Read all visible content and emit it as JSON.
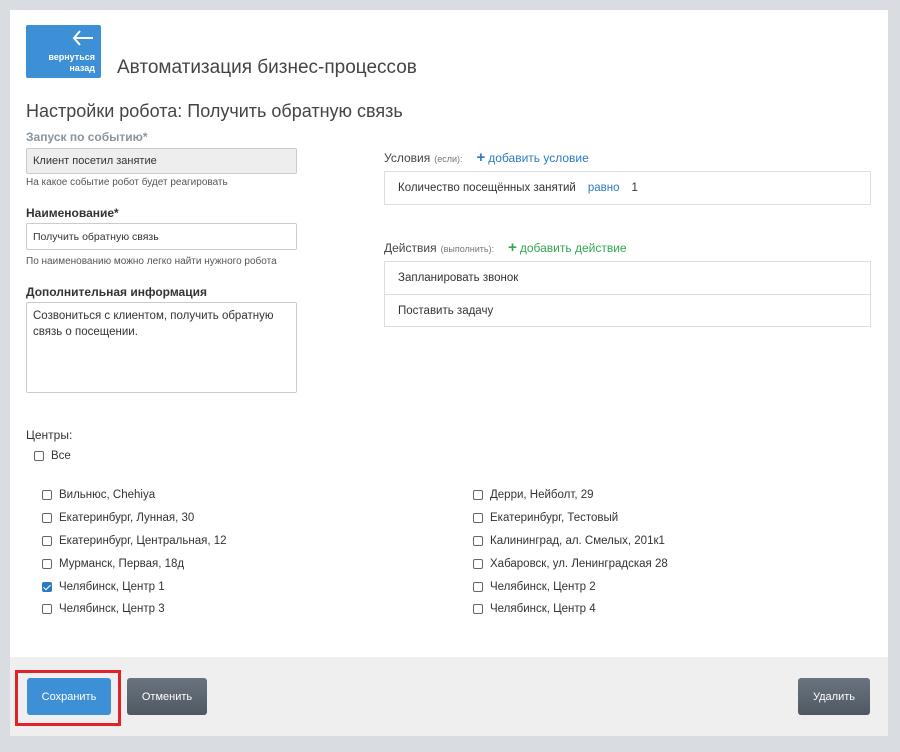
{
  "header": {
    "back_label_line1": "вернуться",
    "back_label_line2": "назад",
    "page_title": "Автоматизация бизнес-процессов",
    "section_title": "Настройки робота: Получить обратную связь"
  },
  "form": {
    "trigger_label": "Запуск по событию*",
    "trigger_value": "Клиент посетил занятие",
    "trigger_hint": "На какое событие робот будет реагировать",
    "name_label": "Наименование*",
    "name_value": "Получить обратную связь",
    "name_hint": "По наименованию можно легко найти нужного робота",
    "info_label": "Дополнительная информация",
    "info_value": "Созвониться с клиентом, получить обратную связь о посещении."
  },
  "conditions": {
    "title": "Условия",
    "subtitle": "(если):",
    "add_label": "добавить условие",
    "items": [
      {
        "field": "Количество посещённых занятий",
        "operator": "равно",
        "value": "1"
      }
    ]
  },
  "actions": {
    "title": "Действия",
    "subtitle": "(выполнить):",
    "add_label": "добавить действие",
    "items": [
      {
        "label": "Запланировать звонок"
      },
      {
        "label": "Поставить задачу"
      }
    ]
  },
  "centers": {
    "label": "Центры:",
    "all_label": "Все",
    "all_checked": false,
    "items": [
      {
        "label": "Вильнюс, Chehiya",
        "checked": false
      },
      {
        "label": "Дерри, Нейболт, 29",
        "checked": false
      },
      {
        "label": "Екатеринбург, Лунная, 30",
        "checked": false
      },
      {
        "label": "Екатеринбург, Тестовый",
        "checked": false
      },
      {
        "label": "Екатеринбург, Центральная, 12",
        "checked": false
      },
      {
        "label": "Калининград, ал. Смелых, 201к1",
        "checked": false
      },
      {
        "label": "Мурманск, Первая, 18д",
        "checked": false
      },
      {
        "label": "Хабаровск, ул. Ленинградская 28",
        "checked": false
      },
      {
        "label": "Челябинск, Центр 1",
        "checked": true
      },
      {
        "label": "Челябинск, Центр 2",
        "checked": false
      },
      {
        "label": "Челябинск, Центр 3",
        "checked": false
      },
      {
        "label": "Челябинск, Центр 4",
        "checked": false
      }
    ]
  },
  "footer": {
    "save_label": "Сохранить",
    "cancel_label": "Отменить",
    "delete_label": "Удалить"
  },
  "colors": {
    "primary": "#3d8fd6",
    "link_blue": "#2c7bc2",
    "link_green": "#2fa84f",
    "highlight": "#e0222b"
  }
}
